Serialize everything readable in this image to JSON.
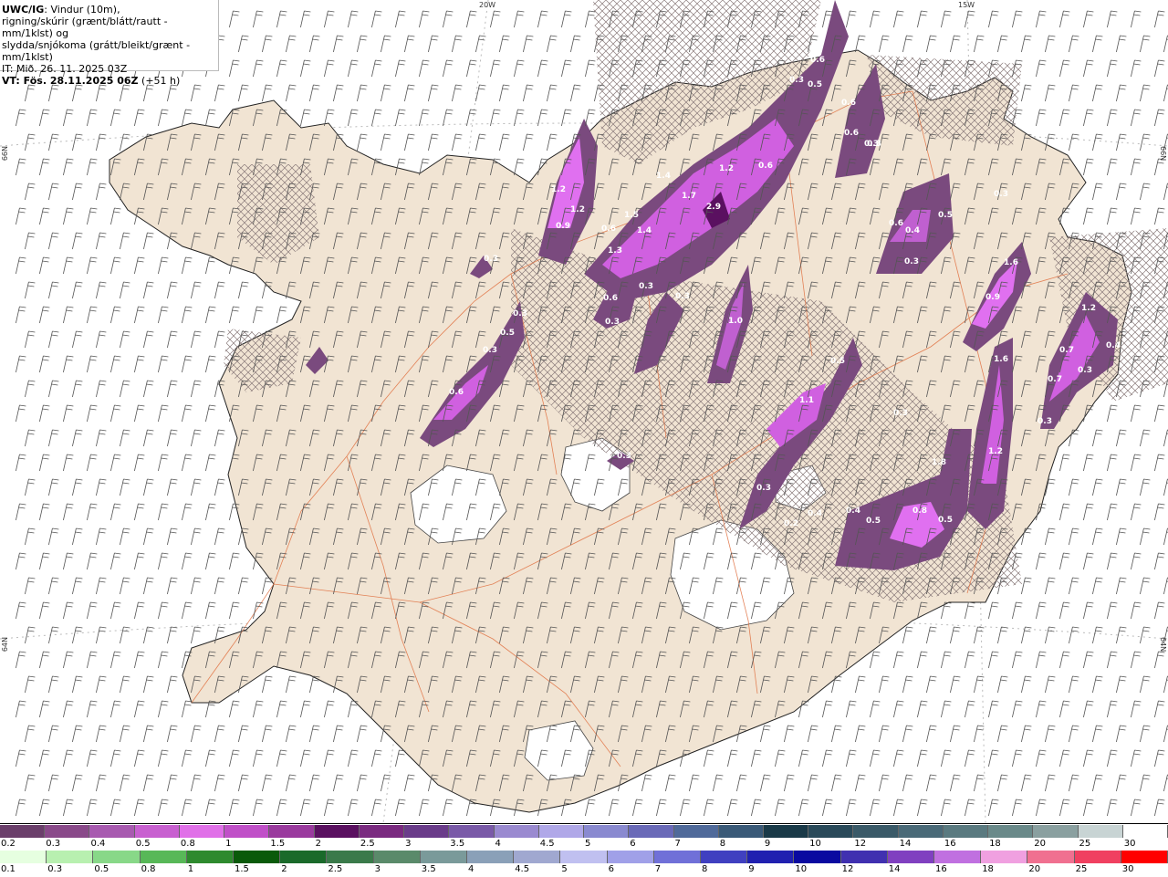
{
  "info": {
    "line1_bold": "UWC/IG",
    "line1_rest": ": Vindur (10m),",
    "line2": "rigning/skúrir (grænt/blátt/rautt - mm/1klst) og",
    "line3": "slydda/snjókoma (grátt/bleikt/grænt - mm/1klst)",
    "line4": "IT: Mið. 26. 11. 2025 03Z",
    "line5_bold": "VT: Fös. 28.11.2025 06Z",
    "line5_rest": " (+51 h)"
  },
  "grid_labels": {
    "lon_20w": "20W",
    "lon_15w": "15W",
    "lat_66n_left": "66N",
    "lat_66n_right": "66N",
    "lat_64n_left": "64N",
    "lat_64n_right": "64N"
  },
  "precip_values": [
    "0.6",
    "0.3",
    "0.5",
    "0.6",
    "0.6",
    "0.3",
    "1.2",
    "1.2",
    "0.9",
    "1.4",
    "1.2",
    "1.7",
    "2.9",
    "1.5",
    "0.6",
    "1.3",
    "1.4",
    "0.6",
    "0.3",
    "0.5",
    "0.6",
    "0.4",
    "0.3",
    "0.3",
    "0.3",
    "0.6",
    "0.3",
    "0.6",
    "0.3",
    "0.3",
    "1.0",
    "0.3",
    "0.5",
    "1.1",
    "0.3",
    "1.6",
    "0.9",
    "1.6",
    "1.2",
    "1.8",
    "0.3",
    "0.5",
    "0.4",
    "0.5",
    "0.8",
    "0.5",
    "0.2",
    "0.7",
    "0.7",
    "0.4",
    "0.3",
    "0.3",
    "1.2",
    "0.3",
    "0.4",
    "0.3"
  ],
  "legend": {
    "snow_labels": [
      "0.2",
      "0.3",
      "0.4",
      "0.5",
      "0.8",
      "1",
      "1.5",
      "2",
      "2.5",
      "3",
      "3.5",
      "4",
      "4.5",
      "5",
      "6",
      "7",
      "8",
      "9",
      "10",
      "12",
      "14",
      "16",
      "18",
      "20",
      "25",
      "30"
    ],
    "snow_colors": [
      "#6b3f6b",
      "#8a4a8a",
      "#a85ab0",
      "#c860d0",
      "#e070e8",
      "#c050c8",
      "#9a3a9e",
      "#5a1060",
      "#7a2a80",
      "#6a3c8a",
      "#7a5aa8",
      "#9a8ad0",
      "#b0a8e8",
      "#8a8ad0",
      "#6a6ab8",
      "#506a9a",
      "#3a5a78",
      "#1a3a48",
      "#2a4a5a",
      "#3a5a68",
      "#4a6a78",
      "#5a7a80",
      "#6a8a8a",
      "#8aa0a0",
      "#c8d4d4",
      "#ffffff"
    ],
    "rain_labels": [
      "0.1",
      "0.3",
      "0.5",
      "0.8",
      "1",
      "1.5",
      "2",
      "2.5",
      "3",
      "3.5",
      "4",
      "4.5",
      "5",
      "6",
      "7",
      "8",
      "9",
      "10",
      "12",
      "14",
      "16",
      "18",
      "20",
      "25",
      "30"
    ],
    "rain_colors": [
      "#e6ffe0",
      "#b8f0b0",
      "#88d888",
      "#58b858",
      "#2e8a2e",
      "#0a5a0a",
      "#1a6a2a",
      "#3a7a4a",
      "#5a8a6a",
      "#7a9a9a",
      "#8aa0b8",
      "#a0a8d0",
      "#c0c0f0",
      "#a0a0e8",
      "#7070d8",
      "#4040c0",
      "#2020b0",
      "#0a0aa0",
      "#4030b0",
      "#8040c0",
      "#c070e0",
      "#f0a0e0",
      "#f07090",
      "#f04060",
      "#ff0000"
    ]
  }
}
